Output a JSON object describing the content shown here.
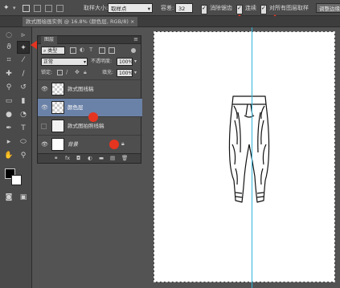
{
  "options_bar": {
    "sample_size_label": "取样大小:",
    "sample_size_value": "取样点",
    "tolerance_label": "容差:",
    "tolerance_value": "32",
    "antialias_label": "消除锯齿",
    "contiguous_label": "连续",
    "sample_all_layers_label": "对所有图层取样",
    "refine_edge_label": "调整边缘...",
    "antialias_checked": true,
    "contiguous_checked": true,
    "sample_all_layers_checked": true
  },
  "document_tab": {
    "title": "款式图绘画实例 @ 16.8% (颜色层, RGB/8) ×"
  },
  "layers_panel": {
    "tab_label": "图层",
    "filter_kind": "类型",
    "blend_mode": "正常",
    "opacity_label": "不透明度:",
    "opacity_value": "100%",
    "lock_label": "锁定:",
    "fill_label": "填充:",
    "fill_value": "100%",
    "layers": [
      {
        "name": "款式图线稿",
        "selected": false,
        "visible": true
      },
      {
        "name": "颜色层",
        "selected": true,
        "visible": true
      },
      {
        "name": "款式图拍照线稿",
        "selected": false,
        "visible": false
      },
      {
        "name": "背景",
        "selected": false,
        "visible": true,
        "locked": true
      }
    ],
    "footer_icons": [
      "link-icon",
      "fx-icon",
      "mask-icon",
      "adjustment-icon",
      "group-icon",
      "new-layer-icon",
      "trash-icon"
    ]
  },
  "colors": {
    "annotation_red": "#e53420",
    "guide_cyan": "#2fb4d8",
    "selected_layer": "#6b82a8"
  }
}
